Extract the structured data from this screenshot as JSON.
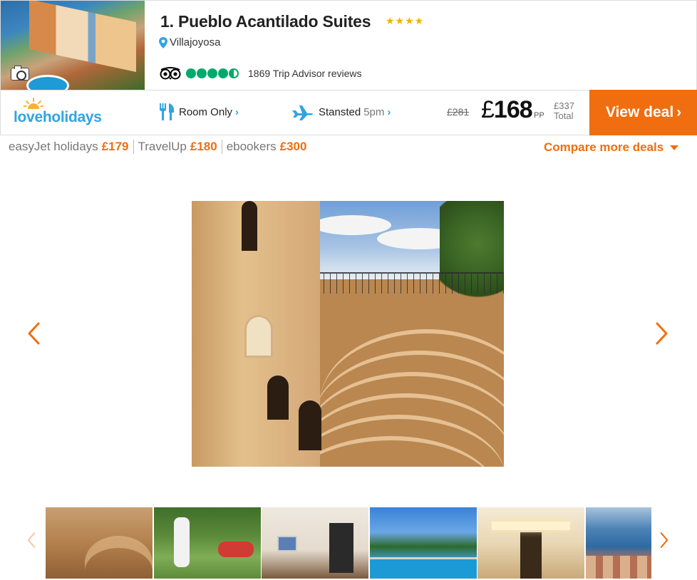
{
  "hotel": {
    "title": "1. Pueblo Acantilado Suites",
    "stars": "★★★★",
    "location": "Villajoyosa",
    "tripadvisor": {
      "rating_bubbles": 4.5,
      "reviews": "1869 Trip Advisor reviews"
    }
  },
  "deal": {
    "provider": "loveholidays",
    "board": "Room Only",
    "airport": "Stansted",
    "time": "5pm",
    "old_price": "£281",
    "currency": "£",
    "price": "168",
    "pp": "PP",
    "total_price": "£337",
    "total_label": "Total",
    "cta": "View deal"
  },
  "other_deals": [
    {
      "name": "easyJet holidays",
      "price": "£179"
    },
    {
      "name": "TravelUp",
      "price": "£180"
    },
    {
      "name": "ebookers",
      "price": "£300"
    }
  ],
  "compare_label": "Compare more deals",
  "colors": {
    "accent": "#f06e0f",
    "brand_blue": "#2fa5e0",
    "tripadvisor_green": "#00aa6c",
    "star": "#f2b200"
  },
  "icons": [
    "camera-icon",
    "location-pin-icon",
    "tripadvisor-owl-icon",
    "cutlery-icon",
    "plane-icon",
    "chevron-right-icon",
    "chevron-left-icon",
    "caret-down-icon",
    "sun-icon"
  ],
  "gallery": {
    "thumbnails": [
      "amphitheatre",
      "garden-games",
      "kitchen",
      "pool",
      "courtyard",
      "sea-view"
    ]
  }
}
